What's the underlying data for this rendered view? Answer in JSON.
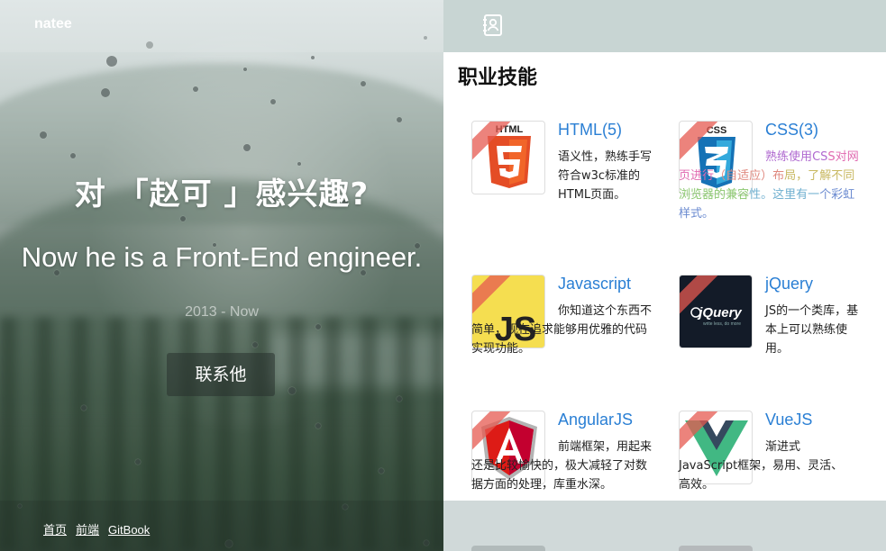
{
  "brand": "natee",
  "hero": {
    "title": "对 「赵可 」感兴趣?",
    "subtitle": "Now he is a Front-End engineer.",
    "date": "2013 - Now",
    "contact_button": "联系他"
  },
  "footer": {
    "links": [
      "首页",
      "前端",
      "GitBook"
    ]
  },
  "right_panel": {
    "header_icon": "contact-book-icon",
    "section_title": "职业技能",
    "skills": [
      {
        "title": "HTML(5)",
        "desc": "语义性，熟练手写符合w3c标准的HTML页面。",
        "icon": "html5-logo"
      },
      {
        "title": "CSS(3)",
        "desc": "熟练使用CSS对网页进行（自适应）布局，了解不同浏览器的兼容性。这里有一个彩虹样式。",
        "icon": "css3-logo"
      },
      {
        "title": "Javascript",
        "desc": "你知道这个东西不简单，现在追求能够用优雅的代码实现功能。",
        "icon": "js-logo"
      },
      {
        "title": "jQuery",
        "desc": "JS的一个类库，基本上可以熟练使用。",
        "icon": "jquery-logo"
      },
      {
        "title": "AngularJS",
        "desc": "前端框架，用起来还是比较愉快的，极大减轻了对数据方面的处理，库重水深。",
        "icon": "angular-logo"
      },
      {
        "title": "VueJS",
        "desc": "渐进式JavaScript框架，易用、灵活、高效。",
        "icon": "vue-logo"
      }
    ]
  },
  "colors": {
    "accent": "#2a7fd4",
    "ribbon": "#e65a50"
  }
}
